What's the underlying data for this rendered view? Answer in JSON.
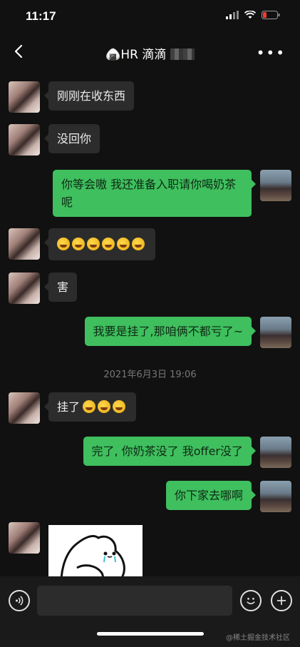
{
  "status": {
    "time": "11:17"
  },
  "header": {
    "title": "HR 滴滴",
    "title_emoji": "🍙",
    "more_label": "•••"
  },
  "messages": [
    {
      "side": "left",
      "text": "刚刚在收东西"
    },
    {
      "side": "left",
      "text": "没回你"
    },
    {
      "side": "right",
      "text": "你等会嗷 我还准备入职请你喝奶茶呢"
    },
    {
      "side": "left",
      "emoji_count": 6
    },
    {
      "side": "left",
      "text": "害"
    },
    {
      "side": "right",
      "text": "我要是挂了,那咱俩不都亏了~"
    },
    {
      "side": "left",
      "text": "挂了",
      "emoji_count": 3
    },
    {
      "side": "right",
      "text": "完了, 你奶茶没了 我offer没了"
    },
    {
      "side": "right",
      "text": "你下家去哪啊"
    },
    {
      "side": "left",
      "type": "sticker"
    }
  ],
  "timestamp": "2021年6月3日 19:06",
  "input": {
    "placeholder": ""
  },
  "watermark": "@稀土掘金技术社区"
}
